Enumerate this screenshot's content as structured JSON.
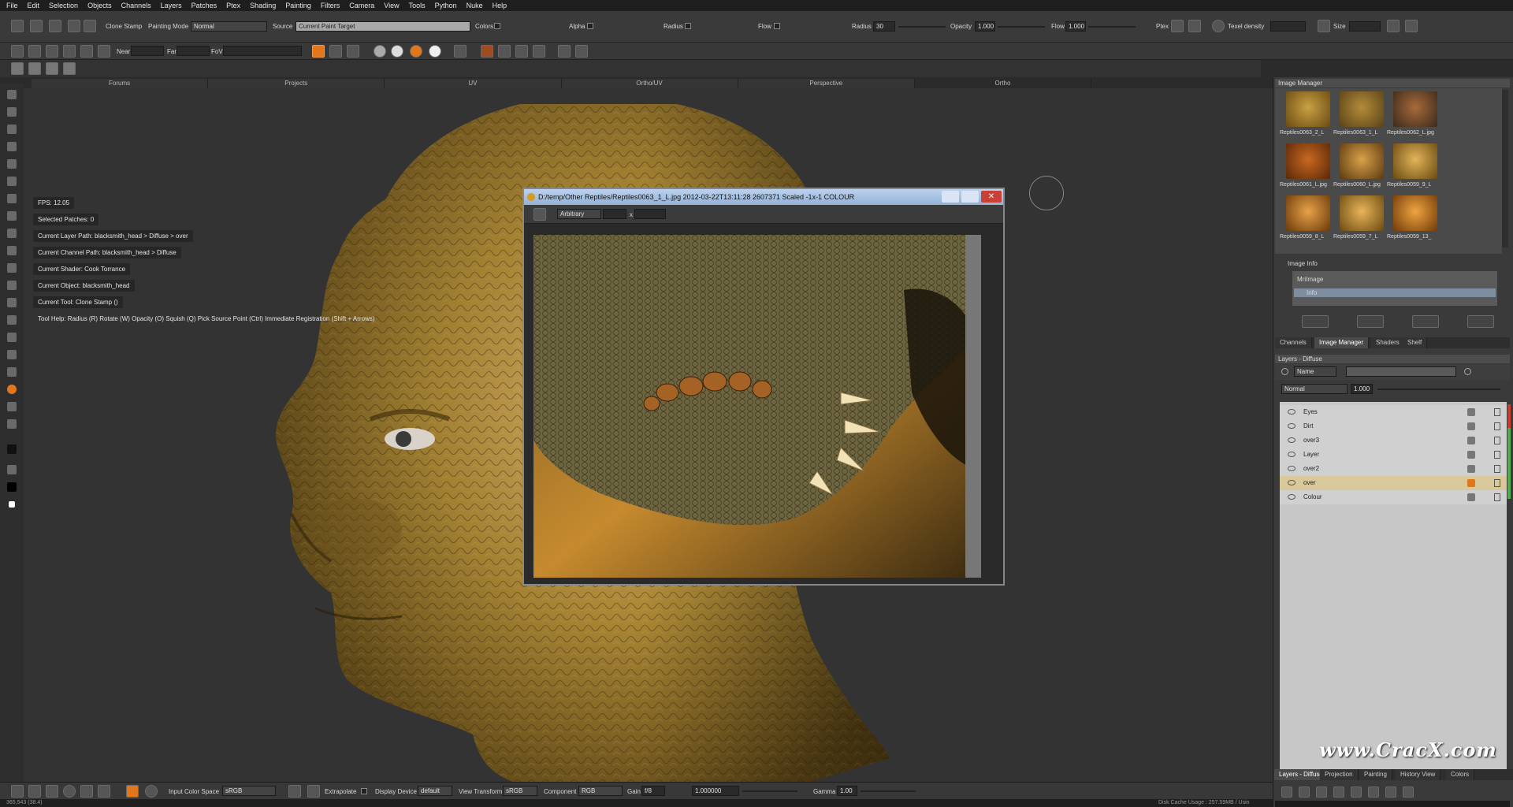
{
  "menu": [
    "File",
    "Edit",
    "Selection",
    "Objects",
    "Channels",
    "Layers",
    "Patches",
    "Ptex",
    "Shading",
    "Painting",
    "Filters",
    "Camera",
    "View",
    "Tools",
    "Python",
    "Nuke",
    "Help"
  ],
  "toolbar1": {
    "tool_name": "Clone Stamp",
    "painting_mode_label": "Painting Mode",
    "painting_mode_value": "Normal",
    "source_label": "Source",
    "source_value": "Current Paint Target",
    "colors_label": "Colors",
    "alpha_label": "Alpha",
    "radius_label": "Radius",
    "flow_label": "Flow",
    "radius2_label": "Radius",
    "radius2_value": "30",
    "opacity_label": "Opacity",
    "opacity_value": "1.000",
    "flow2_label": "Flow",
    "flow2_value": "1.000",
    "ptex_label": "Ptex",
    "texel_density_label": "Texel density",
    "size_label": "Size"
  },
  "toolbar2": {
    "near_label": "Near",
    "far_label": "Far",
    "fov_label": "FoV"
  },
  "view_tabs": [
    "Forums",
    "Projects",
    "UV",
    "Ortho/UV",
    "Perspective",
    "Ortho"
  ],
  "active_tab": "Ortho",
  "hud": {
    "fps": "FPS: 12.05",
    "selected_patches": "Selected Patches: 0",
    "layer_path": "Current Layer Path: blacksmith_head > Diffuse > over",
    "channel_path": "Current Channel Path: blacksmith_head > Diffuse",
    "shader": "Current Shader: Cook Torrance",
    "object": "Current Object: blacksmith_head",
    "tool": "Current Tool: Clone Stamp ()",
    "help": "Tool Help:   Radius (R)   Rotate (W)   Opacity (O)   Squish (Q)   Pick Source Point (Ctrl)   Immediate Registration (Shift + Arrows)"
  },
  "image_window": {
    "title": "D:/temp/Other Reptiles/Reptiles0063_1_L.jpg 2012-03-22T13:11:28 2607371 Scaled -1x-1 COLOUR",
    "mode_value": "Arbitrary",
    "x_label": "x"
  },
  "image_manager": {
    "title": "Image Manager",
    "thumbs": [
      {
        "label": "Reptiles0063_2_L",
        "colors": [
          "#6a4a12",
          "#c9a144"
        ]
      },
      {
        "label": "Reptiles0063_1_L",
        "colors": [
          "#5a4316",
          "#b48b3b"
        ]
      },
      {
        "label": "Reptiles0062_L.jpg",
        "colors": [
          "#3a2a1c",
          "#a86a3a"
        ]
      },
      {
        "label": "Reptiles0061_L.jpg",
        "colors": [
          "#5a2808",
          "#c96820"
        ]
      },
      {
        "label": "Reptiles0060_L.jpg",
        "colors": [
          "#5a3a10",
          "#d9a14a"
        ]
      },
      {
        "label": "Reptiles0059_9_L",
        "colors": [
          "#6a4a10",
          "#e2b45a"
        ]
      },
      {
        "label": "Reptiles0059_8_L",
        "colors": [
          "#6a3a08",
          "#e8a24a"
        ]
      },
      {
        "label": "Reptiles0059_7_L",
        "colors": [
          "#6a4a10",
          "#e8b45a"
        ]
      },
      {
        "label": "Reptiles0059_13_",
        "colors": [
          "#703a08",
          "#f0a440"
        ]
      }
    ],
    "info_title": "Image Info",
    "info_root": "MriImage",
    "info_child": "Info"
  },
  "panel_tabs_top": [
    "Channels",
    "Image Manager",
    "Shaders",
    "Shelf"
  ],
  "panel_tabs_top_active": "Image Manager",
  "layers": {
    "title": "Layers - Diffuse",
    "filter_value": "Name",
    "blend_value": "Normal",
    "opacity_value": "1.000",
    "rows": [
      {
        "name": "Eyes",
        "selected": false,
        "bar": "#d0d0d0"
      },
      {
        "name": "Dirt",
        "selected": false,
        "bar": "#d0d0d0"
      },
      {
        "name": "over3",
        "selected": false,
        "bar": "#d0d0d0"
      },
      {
        "name": "Layer",
        "selected": false,
        "bar": "#d0d0d0"
      },
      {
        "name": "over2",
        "selected": false,
        "bar": "#d0d0d0"
      },
      {
        "name": "over",
        "selected": true,
        "bar": "#d9c99a"
      },
      {
        "name": "Colour",
        "selected": false,
        "bar": "#d0d0d0"
      }
    ]
  },
  "panel_tabs_bottom": [
    "Layers - Diffuse",
    "Projection",
    "Painting",
    "History View",
    "Colors"
  ],
  "panel_tabs_bottom_active": "Layers - Diffuse",
  "bottombar": {
    "input_color_space_label": "Input Color Space",
    "input_color_space_value": "sRGB",
    "extrapolate_label": "Extrapolate",
    "display_device_label": "Display Device",
    "display_device_value": "default",
    "view_transform_label": "View Transform",
    "view_transform_value": "sRGB",
    "component_label": "Component",
    "component_value": "RGB",
    "gain_label": "Gain",
    "gain_value": "f/8",
    "gain_num": "1.000000",
    "gamma_label": "Gamma",
    "gamma_value": "1.00"
  },
  "status": {
    "left": "365,543 (38.4)",
    "right": "Disk Cache Usage : 257.59MB / Usin"
  },
  "watermark": "www.CracX.com",
  "colors": {
    "accent_orange": "#e2761b",
    "selected_layer": "#d9c99a"
  }
}
